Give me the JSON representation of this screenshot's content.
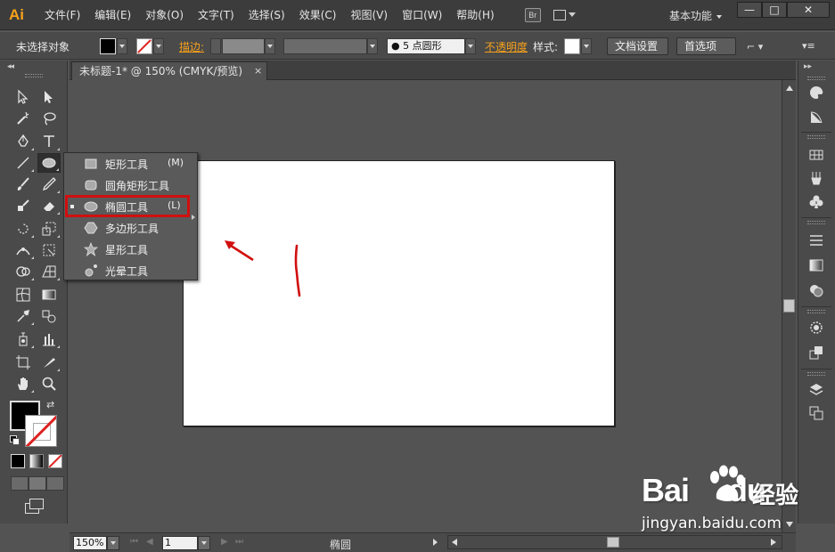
{
  "app": {
    "logo": "Ai",
    "menu": [
      "文件(F)",
      "编辑(E)",
      "对象(O)",
      "文字(T)",
      "选择(S)",
      "效果(C)",
      "视图(V)",
      "窗口(W)",
      "帮助(H)"
    ],
    "bridge_label": "Br",
    "workspace": "基本功能",
    "window_controls": {
      "minimize": "—",
      "maximize": "□",
      "close": "✕"
    }
  },
  "control_bar": {
    "selection_status": "未选择对象",
    "stroke_label": "描边:",
    "brush": "● 5 点圆形",
    "opacity_label": "不透明度",
    "style_label": "样式:",
    "doc_setup": "文档设置",
    "preferences": "首选项",
    "colors": {
      "fill": "#000000",
      "stroke": "none"
    }
  },
  "document": {
    "tab_title": "未标题-1* @ 150% (CMYK/预览)",
    "tab_close": "×"
  },
  "flyout": {
    "items": [
      {
        "label": "矩形工具",
        "shortcut": "(M)",
        "icon": "rectangle-icon",
        "selected": false
      },
      {
        "label": "圆角矩形工具",
        "shortcut": "",
        "icon": "rounded-rectangle-icon",
        "selected": false
      },
      {
        "label": "椭圆工具",
        "shortcut": "(L)",
        "icon": "ellipse-icon",
        "selected": true
      },
      {
        "label": "多边形工具",
        "shortcut": "",
        "icon": "polygon-icon",
        "selected": false
      },
      {
        "label": "星形工具",
        "shortcut": "",
        "icon": "star-icon",
        "selected": false
      },
      {
        "label": "光晕工具",
        "shortcut": "",
        "icon": "flare-icon",
        "selected": false
      }
    ],
    "highlight_color": "#d10f0f"
  },
  "status_bar": {
    "zoom": "150%",
    "page": "1",
    "current_tool": "椭圆"
  },
  "annotation": {
    "color": "#d10f0f"
  },
  "watermark": {
    "brand": "Bai",
    "brand_suffix": "du",
    "product": "经验",
    "url": "jingyan.baidu.com"
  }
}
